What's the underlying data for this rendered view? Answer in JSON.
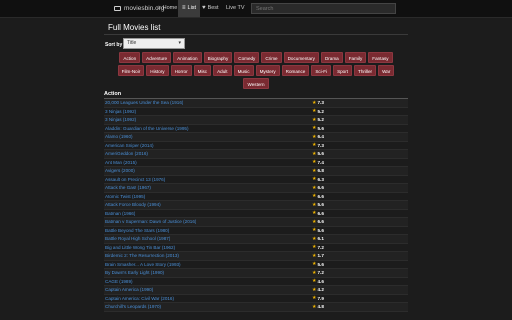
{
  "brand": {
    "name": "moviesbin.org",
    "icon": "tv-icon"
  },
  "nav": {
    "home": {
      "label": "Home",
      "icon": "home-icon"
    },
    "list": {
      "label": "List",
      "icon": "list-icon"
    },
    "best": {
      "label": "Best",
      "icon": "heart-icon"
    },
    "live": {
      "label": "Live TV"
    }
  },
  "search": {
    "placeholder": "Search"
  },
  "page": {
    "title": "Full Movies list"
  },
  "sort": {
    "label": "Sort by",
    "selected": "Title"
  },
  "genres": [
    "Action",
    "Adventure",
    "Animation",
    "Biography",
    "Comedy",
    "Crime",
    "Documentary",
    "Drama",
    "Family",
    "Fantasy",
    "Film-Noir",
    "History",
    "Horror",
    "Misc",
    "Adult",
    "Music",
    "Mystery",
    "Romance",
    "Sci-Fi",
    "Sport",
    "Thriller",
    "War",
    "Western"
  ],
  "section": {
    "title": "Action"
  },
  "movies": [
    {
      "title": "20,000 Leagues Under the Sea (1916)",
      "rating": "7.3"
    },
    {
      "title": "3 Ninjas (1992)",
      "rating": "5.2"
    },
    {
      "title": "3 Ninjas (1992)",
      "rating": "5.2"
    },
    {
      "title": "Aladdin: Guardian of the Universe (1995)",
      "rating": "5.6"
    },
    {
      "title": "Alamo (1960)",
      "rating": "6.4"
    },
    {
      "title": "American Sniper (2014)",
      "rating": "7.3"
    },
    {
      "title": "AmeriGeddon (2016)",
      "rating": "5.6"
    },
    {
      "title": "Ant Man (2015)",
      "rating": "7.4"
    },
    {
      "title": "Avigers (2000)",
      "rating": "6.8"
    },
    {
      "title": "Assault on Precinct 13 (1976)",
      "rating": "6.3"
    },
    {
      "title": "Attack the Gas! (1967)",
      "rating": "6.6"
    },
    {
      "title": "Atomic Twist (1995)",
      "rating": "6.6"
    },
    {
      "title": "Attack Force Bloody (1994)",
      "rating": "5.6"
    },
    {
      "title": "Batman (1966)",
      "rating": "6.6"
    },
    {
      "title": "Batman v Superman: Dawn of Justice (2016)",
      "rating": "6.6"
    },
    {
      "title": "Battle Beyond The Stars (1980)",
      "rating": "5.6"
    },
    {
      "title": "Battle Royal High School (1987)",
      "rating": "6.1"
    },
    {
      "title": "Big and Little Wong Tin Bar (1962)",
      "rating": "7.2"
    },
    {
      "title": "Birdemic 2: The Resurrection (2013)",
      "rating": "1.7"
    },
    {
      "title": "Brain Smasher... A Love Story (1993)",
      "rating": "5.6"
    },
    {
      "title": "By Dawn's Early Light (1990)",
      "rating": "7.2"
    },
    {
      "title": "CAGE (1989)",
      "rating": "4.6"
    },
    {
      "title": "Captain America (1990)",
      "rating": "4.2"
    },
    {
      "title": "Captain America: Civil War (2016)",
      "rating": "7.9"
    },
    {
      "title": "Churchill's Leopards (1970)",
      "rating": "4.8"
    }
  ]
}
